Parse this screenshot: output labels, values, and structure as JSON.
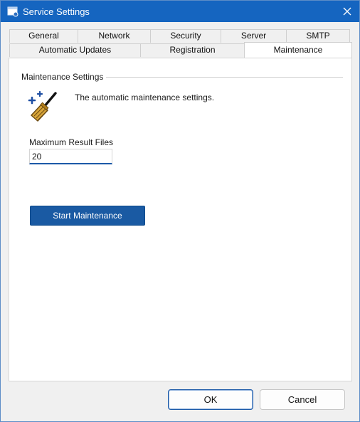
{
  "window": {
    "title": "Service Settings"
  },
  "tabs": {
    "row_top": [
      {
        "label": "General"
      },
      {
        "label": "Network"
      },
      {
        "label": "Security"
      },
      {
        "label": "Server"
      },
      {
        "label": "SMTP"
      }
    ],
    "row_bottom": [
      {
        "label": "Automatic Updates"
      },
      {
        "label": "Registration"
      },
      {
        "label": "Maintenance"
      }
    ],
    "active": "Maintenance"
  },
  "maintenance": {
    "group_title": "Maintenance Settings",
    "description": "The automatic maintenance settings.",
    "max_result_files_label": "Maximum Result Files",
    "max_result_files_value": "20",
    "start_button": "Start Maintenance"
  },
  "footer": {
    "ok": "OK",
    "cancel": "Cancel"
  },
  "colors": {
    "titlebar": "#1565c0",
    "accent_button": "#1a5aa3",
    "broom_gold": "#c8952a",
    "sparkle_blue": "#1f4fa3"
  },
  "icons": {
    "app": "app-window-icon",
    "close": "close-icon",
    "maintenance": "broom-icon"
  }
}
